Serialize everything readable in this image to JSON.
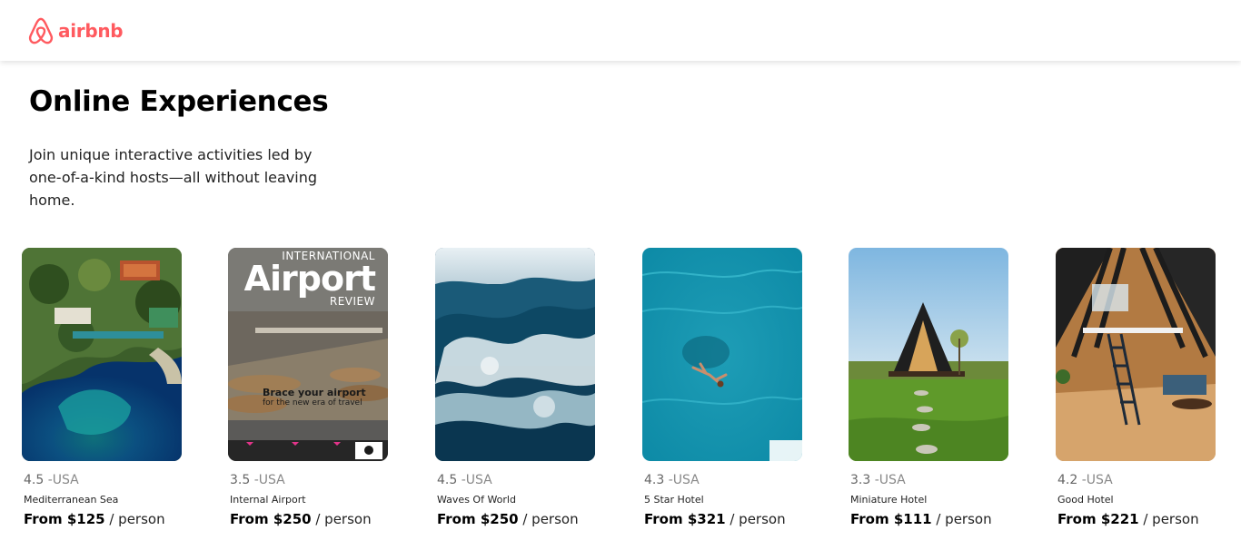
{
  "brand": {
    "name": "airbnb",
    "color": "#FF5A5F"
  },
  "hero": {
    "title": "Online Experiences",
    "description": "Join unique interactive activities led by one-of-a-kind hosts—all without leaving home."
  },
  "cards": [
    {
      "rating": "4.5",
      "country": "-USA",
      "title": "Mediterranean Sea",
      "price": "From $125",
      "unit": " / person",
      "image": "aerial-coast-photo"
    },
    {
      "rating": "3.5",
      "country": "-USA",
      "title": "Internal Airport",
      "price": "From $250",
      "unit": " / person",
      "image": "airport-magazine-cover",
      "magazine": {
        "top": "INTERNATIONAL",
        "main": "Airport",
        "sub": "REVIEW",
        "headline": "Brace your airport",
        "subhead": "for the new era of travel"
      }
    },
    {
      "rating": "4.5",
      "country": "-USA",
      "title": "Waves Of World",
      "price": "From $250",
      "unit": " / person",
      "image": "ocean-waves-photo"
    },
    {
      "rating": "4.3",
      "country": "-USA",
      "title": "5 Star Hotel",
      "price": "From $321",
      "unit": " / person",
      "image": "swimmer-pool-photo"
    },
    {
      "rating": "3.3",
      "country": "-USA",
      "title": "Miniature Hotel",
      "price": "From $111",
      "unit": " / person",
      "image": "a-frame-cabin-photo"
    },
    {
      "rating": "4.2",
      "country": "-USA",
      "title": "Good Hotel",
      "price": "From $221",
      "unit": " / person",
      "image": "a-frame-interior-photo"
    }
  ]
}
